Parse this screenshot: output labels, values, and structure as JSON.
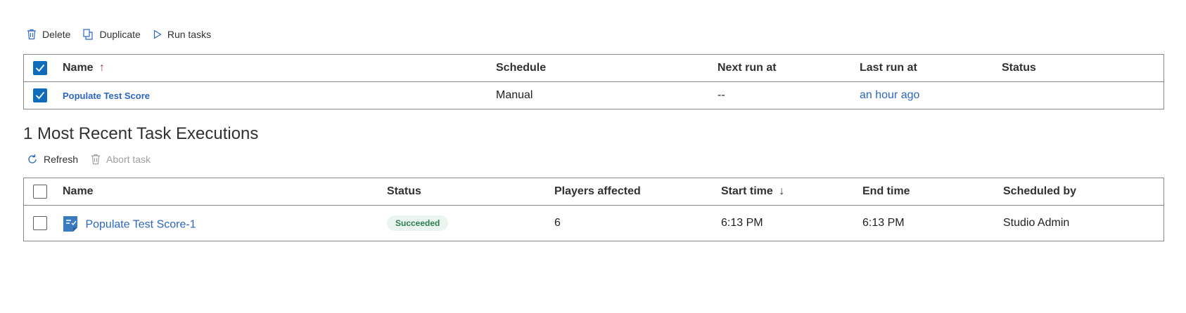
{
  "toolbar_top": {
    "delete_label": "Delete",
    "duplicate_label": "Duplicate",
    "run_label": "Run tasks"
  },
  "tasks_table": {
    "headers": {
      "name": "Name",
      "name_sort": "↑",
      "schedule": "Schedule",
      "next_run": "Next run at",
      "last_run": "Last run at",
      "status": "Status"
    },
    "rows": [
      {
        "name": "Populate Test Score",
        "schedule": "Manual",
        "next_run": "--",
        "last_run": "an hour ago",
        "status": "",
        "checked": true
      }
    ],
    "header_checked": true
  },
  "executions": {
    "title": "1 Most Recent Task Executions",
    "refresh_label": "Refresh",
    "abort_label": "Abort task",
    "headers": {
      "name": "Name",
      "status": "Status",
      "players": "Players affected",
      "start": "Start time",
      "start_sort": "↓",
      "end": "End time",
      "scheduled_by": "Scheduled by"
    },
    "rows": [
      {
        "name": "Populate Test Score-1",
        "status": "Succeeded",
        "players": "6",
        "start": "6:13 PM",
        "end": "6:13 PM",
        "scheduled_by": "Studio Admin",
        "checked": false
      }
    ]
  },
  "colors": {
    "accent": "#0f6cbd",
    "link": "#2b66c0",
    "success_bg": "#e9f5ee",
    "success_text": "#2e7d4f",
    "sort_arrow": "#8b3a5c"
  }
}
